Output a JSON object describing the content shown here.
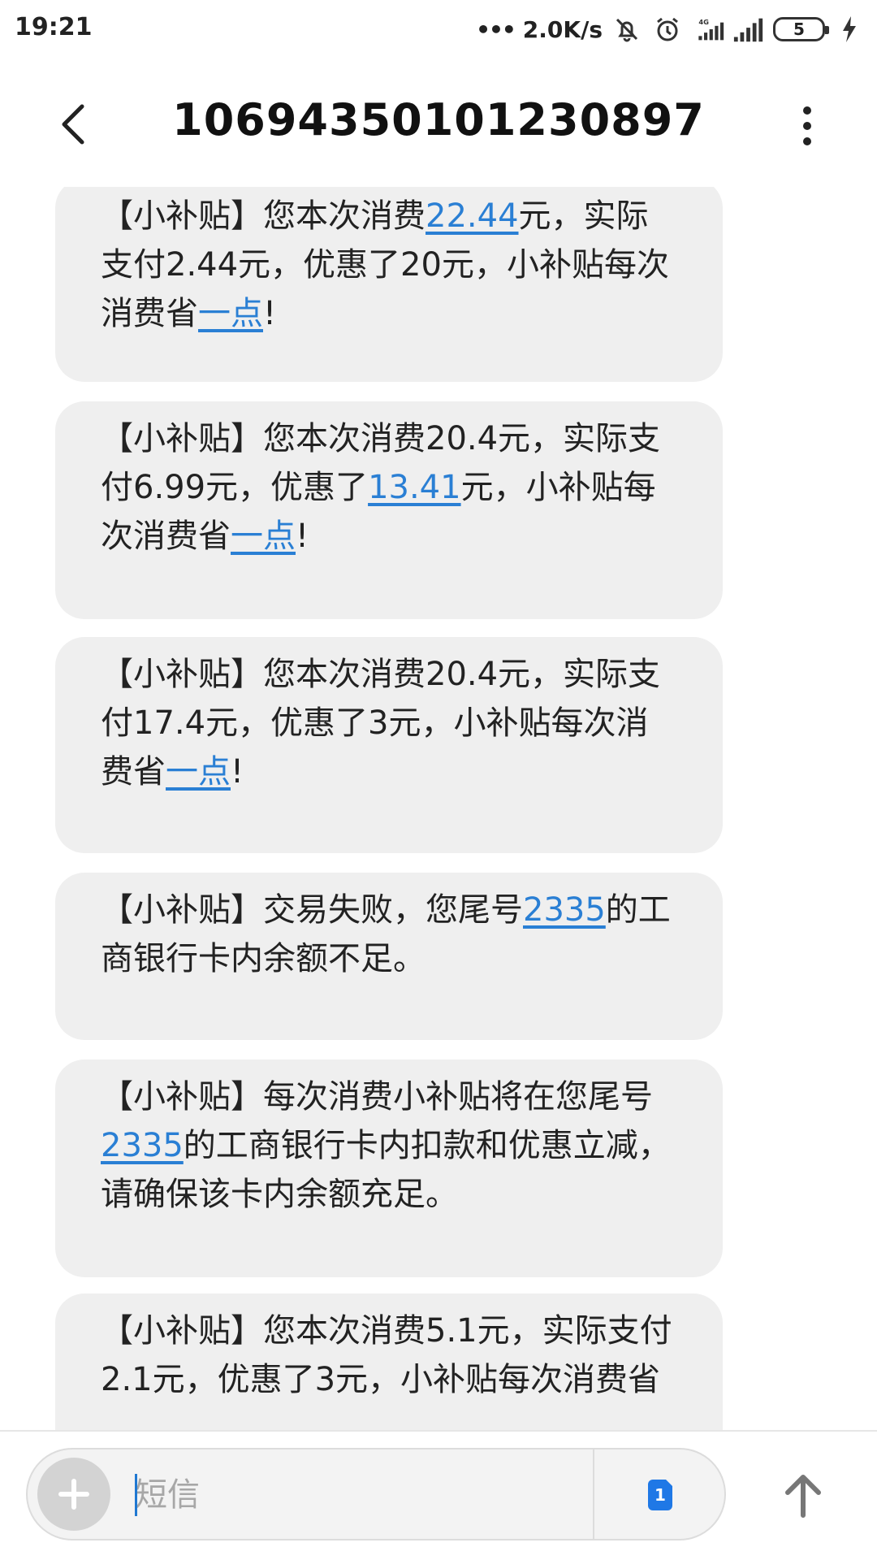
{
  "status_bar": {
    "time": "19:21",
    "net_speed": "2.0K/s",
    "network_type": "4G",
    "battery": "5",
    "icons": [
      "dots-icon",
      "mute-bell-icon",
      "alarm-icon",
      "signal-4g-icon",
      "signal-icon",
      "battery-icon",
      "charging-icon"
    ]
  },
  "header": {
    "title": "10694350101230897",
    "back_icon": "back-arrow-icon",
    "more_icon": "more-vertical-icon"
  },
  "messages": [
    {
      "segments": [
        {
          "text": "【小补贴】您本次消费",
          "link": false
        },
        {
          "text": "22.44",
          "link": true
        },
        {
          "text": "元，实际支付2.44元，优惠了20元，小补贴每次消费省",
          "link": false
        },
        {
          "text": "一点",
          "link": true
        },
        {
          "text": "!",
          "link": false
        }
      ]
    },
    {
      "segments": [
        {
          "text": "【小补贴】您本次消费20.4元，实际支付6.99元，优惠了",
          "link": false
        },
        {
          "text": "13.41",
          "link": true
        },
        {
          "text": "元，小补贴每次消费省",
          "link": false
        },
        {
          "text": "一点",
          "link": true
        },
        {
          "text": "!",
          "link": false
        }
      ]
    },
    {
      "segments": [
        {
          "text": "【小补贴】您本次消费20.4元，实际支付17.4元，优惠了3元，小补贴每次消费省",
          "link": false
        },
        {
          "text": "一点",
          "link": true
        },
        {
          "text": "!",
          "link": false
        }
      ]
    },
    {
      "segments": [
        {
          "text": "【小补贴】交易失败，您尾号",
          "link": false
        },
        {
          "text": "2335",
          "link": true
        },
        {
          "text": "的工商银行卡内余额不足。",
          "link": false
        }
      ]
    },
    {
      "segments": [
        {
          "text": "【小补贴】每次消费小补贴将在您尾号",
          "link": false
        },
        {
          "text": "2335",
          "link": true
        },
        {
          "text": "的工商银行卡内扣款和优惠立减，请确保该卡内余额充足。",
          "link": false
        }
      ]
    },
    {
      "segments": [
        {
          "text": "【小补贴】您本次消费5.1元，实际支付2.1元，优惠了3元，小补贴每次消费省",
          "link": false
        }
      ]
    }
  ],
  "composer": {
    "placeholder": "短信",
    "sim_label": "1",
    "add_icon": "plus-icon",
    "send_icon": "send-arrow-icon"
  },
  "colors": {
    "link": "#2a7fd4",
    "bubble": "#efefef",
    "sim_badge": "#1f78e6"
  }
}
